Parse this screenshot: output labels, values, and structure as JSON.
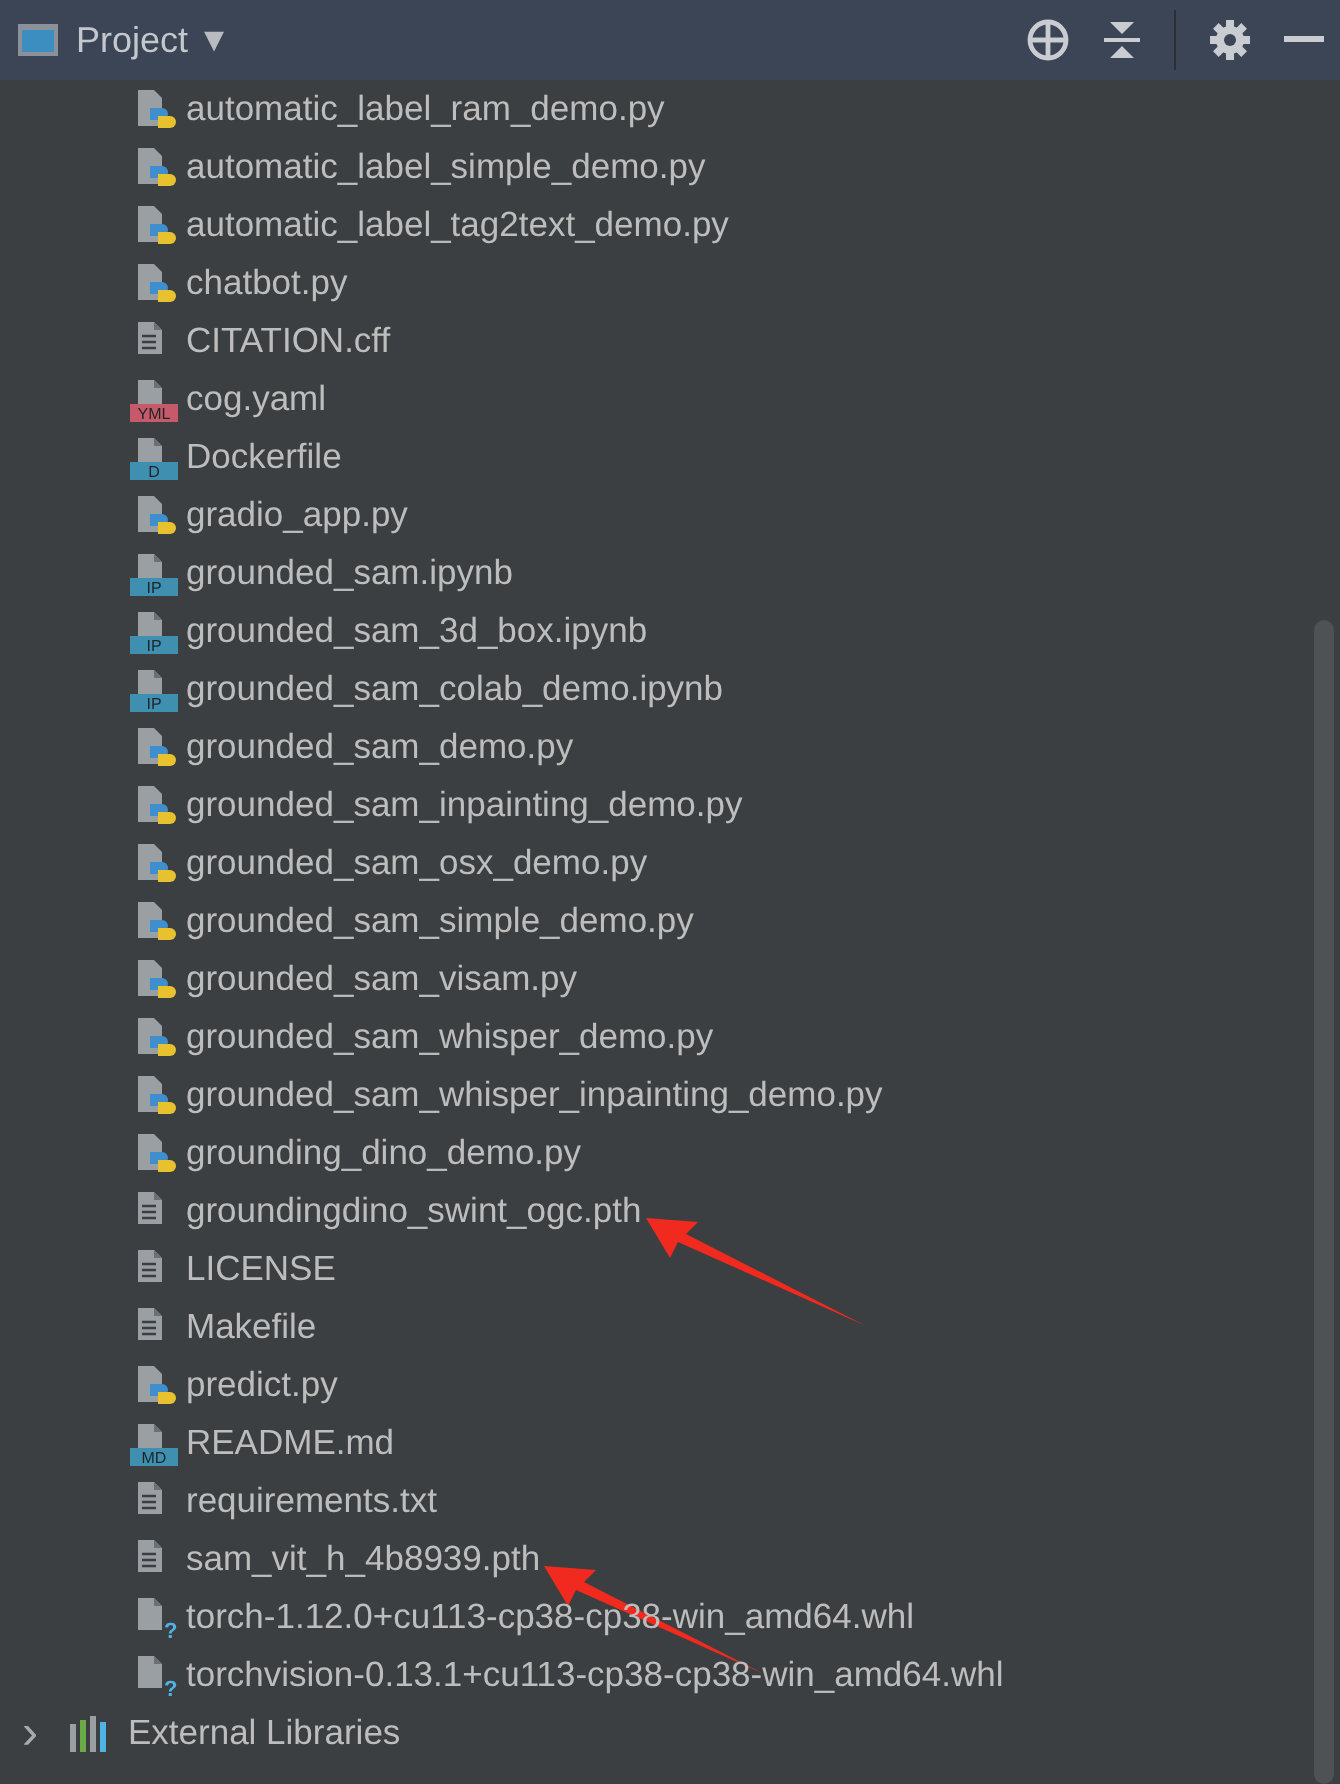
{
  "panel": {
    "title": "Project",
    "dropdown": "▾"
  },
  "files": [
    {
      "name": "automatic_label_ram_demo.py",
      "kind": "python",
      "marked": false
    },
    {
      "name": "automatic_label_simple_demo.py",
      "kind": "python",
      "marked": false
    },
    {
      "name": "automatic_label_tag2text_demo.py",
      "kind": "python",
      "marked": false
    },
    {
      "name": "chatbot.py",
      "kind": "python",
      "marked": false
    },
    {
      "name": "CITATION.cff",
      "kind": "text",
      "marked": false
    },
    {
      "name": "cog.yaml",
      "kind": "yaml",
      "marked": false,
      "badge": "YML"
    },
    {
      "name": "Dockerfile",
      "kind": "docker",
      "marked": false,
      "badge": "D"
    },
    {
      "name": "gradio_app.py",
      "kind": "python",
      "marked": false
    },
    {
      "name": "grounded_sam.ipynb",
      "kind": "notebook",
      "marked": false,
      "badge": "IP"
    },
    {
      "name": "grounded_sam_3d_box.ipynb",
      "kind": "notebook",
      "marked": false,
      "badge": "IP"
    },
    {
      "name": "grounded_sam_colab_demo.ipynb",
      "kind": "notebook",
      "marked": false,
      "badge": "IP"
    },
    {
      "name": "grounded_sam_demo.py",
      "kind": "python",
      "marked": false
    },
    {
      "name": "grounded_sam_inpainting_demo.py",
      "kind": "python",
      "marked": false
    },
    {
      "name": "grounded_sam_osx_demo.py",
      "kind": "python",
      "marked": false
    },
    {
      "name": "grounded_sam_simple_demo.py",
      "kind": "python",
      "marked": false
    },
    {
      "name": "grounded_sam_visam.py",
      "kind": "python",
      "marked": false
    },
    {
      "name": "grounded_sam_whisper_demo.py",
      "kind": "python",
      "marked": false
    },
    {
      "name": "grounded_sam_whisper_inpainting_demo.py",
      "kind": "python",
      "marked": false
    },
    {
      "name": "grounding_dino_demo.py",
      "kind": "python",
      "marked": false
    },
    {
      "name": "groundingdino_swint_ogc.pth",
      "kind": "text",
      "marked": true
    },
    {
      "name": "LICENSE",
      "kind": "text",
      "marked": false
    },
    {
      "name": "Makefile",
      "kind": "text",
      "marked": false
    },
    {
      "name": "predict.py",
      "kind": "python",
      "marked": false
    },
    {
      "name": "README.md",
      "kind": "markdown",
      "marked": false,
      "badge": "MD"
    },
    {
      "name": "requirements.txt",
      "kind": "text",
      "marked": false
    },
    {
      "name": "sam_vit_h_4b8939.pth",
      "kind": "text",
      "marked": true
    },
    {
      "name": "torch-1.12.0+cu113-cp38-cp38-win_amd64.whl",
      "kind": "unknown",
      "marked": false,
      "badge": "?"
    },
    {
      "name": "torchvision-0.13.1+cu113-cp38-cp38-win_amd64.whl",
      "kind": "unknown",
      "marked": false,
      "badge": "?"
    }
  ],
  "libraries": {
    "label": "External Libraries",
    "expanded": false,
    "chevron": "›"
  }
}
